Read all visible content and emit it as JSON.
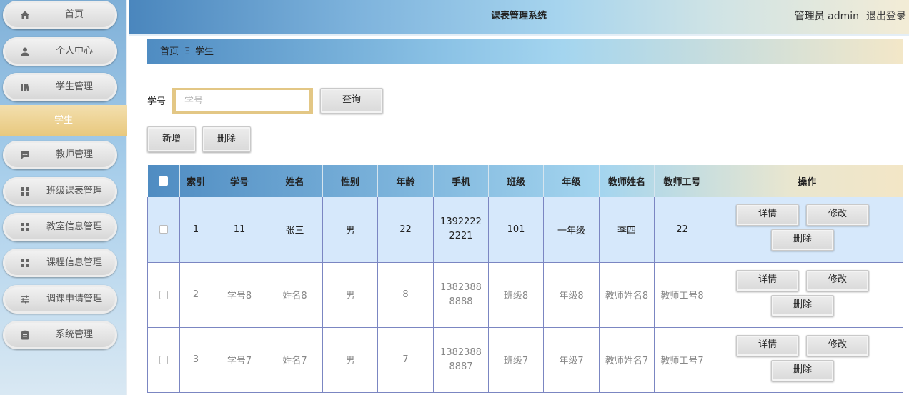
{
  "sidebar": {
    "items": [
      {
        "label": "首页",
        "icon": "home-icon"
      },
      {
        "label": "个人中心",
        "icon": "user-icon"
      },
      {
        "label": "学生管理",
        "icon": "book-icon"
      },
      {
        "label": "学生",
        "active": true
      },
      {
        "label": "教师管理",
        "icon": "chat-icon"
      },
      {
        "label": "班级课表管理",
        "icon": "grid-icon"
      },
      {
        "label": "教室信息管理",
        "icon": "grid-icon"
      },
      {
        "label": "课程信息管理",
        "icon": "grid-icon"
      },
      {
        "label": "调课申请管理",
        "icon": "sliders-icon"
      },
      {
        "label": "系统管理",
        "icon": "clipboard-icon"
      }
    ]
  },
  "header": {
    "title": "课表管理系统",
    "user": "管理员 admin",
    "logout": "退出登录"
  },
  "breadcrumb": {
    "home": "首页",
    "separator": "Ξ",
    "current": "学生"
  },
  "search": {
    "label": "学号",
    "placeholder": "学号",
    "value": "",
    "query_label": "查询"
  },
  "toolbar": {
    "add_label": "新增",
    "delete_label": "删除"
  },
  "table": {
    "columns": [
      "索引",
      "学号",
      "姓名",
      "性别",
      "年龄",
      "手机",
      "班级",
      "年级",
      "教师姓名",
      "教师工号",
      "操作"
    ],
    "rows": [
      {
        "index": "1",
        "student_id": "11",
        "name": "张三",
        "gender": "男",
        "age": "22",
        "phone_1": "1392222",
        "phone_2": "2221",
        "class": "101",
        "grade": "一年级",
        "teacher_name": "李四",
        "teacher_id": "22",
        "selected": true
      },
      {
        "index": "2",
        "student_id": "学号8",
        "name": "姓名8",
        "gender": "男",
        "age": "8",
        "phone_1": "1382388",
        "phone_2": "8888",
        "class": "班级8",
        "grade": "年级8",
        "teacher_name": "教师姓名8",
        "teacher_id": "教师工号8",
        "selected": false
      },
      {
        "index": "3",
        "student_id": "学号7",
        "name": "姓名7",
        "gender": "男",
        "age": "7",
        "phone_1": "1382388",
        "phone_2": "8887",
        "class": "班级7",
        "grade": "年级7",
        "teacher_name": "教师姓名7",
        "teacher_id": "教师工号7",
        "selected": false
      }
    ],
    "actions": {
      "detail": "详情",
      "edit": "修改",
      "delete": "删除"
    }
  },
  "colors": {
    "accent_gold": "#e8c87d",
    "header_blue": "#4a86bd",
    "row_selected": "#d6e8fb",
    "grid_border": "#7b86c2"
  }
}
